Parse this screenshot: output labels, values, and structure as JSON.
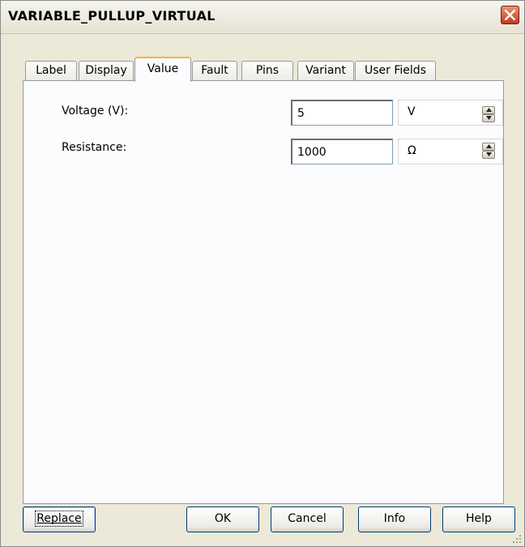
{
  "window": {
    "title": "VARIABLE_PULLUP_VIRTUAL"
  },
  "tabs": [
    {
      "label": "Label"
    },
    {
      "label": "Display"
    },
    {
      "label": "Value"
    },
    {
      "label": "Fault"
    },
    {
      "label": "Pins"
    },
    {
      "label": "Variant"
    },
    {
      "label": "User Fields"
    }
  ],
  "active_tab": "Value",
  "fields": {
    "voltage": {
      "label": "Voltage (V):",
      "value": "5",
      "unit": "V"
    },
    "resistance": {
      "label": "Resistance:",
      "value": "1000",
      "unit": "Ω"
    }
  },
  "buttons": {
    "replace": "Replace",
    "ok": "OK",
    "cancel": "Cancel",
    "info": "Info",
    "help": "Help"
  }
}
